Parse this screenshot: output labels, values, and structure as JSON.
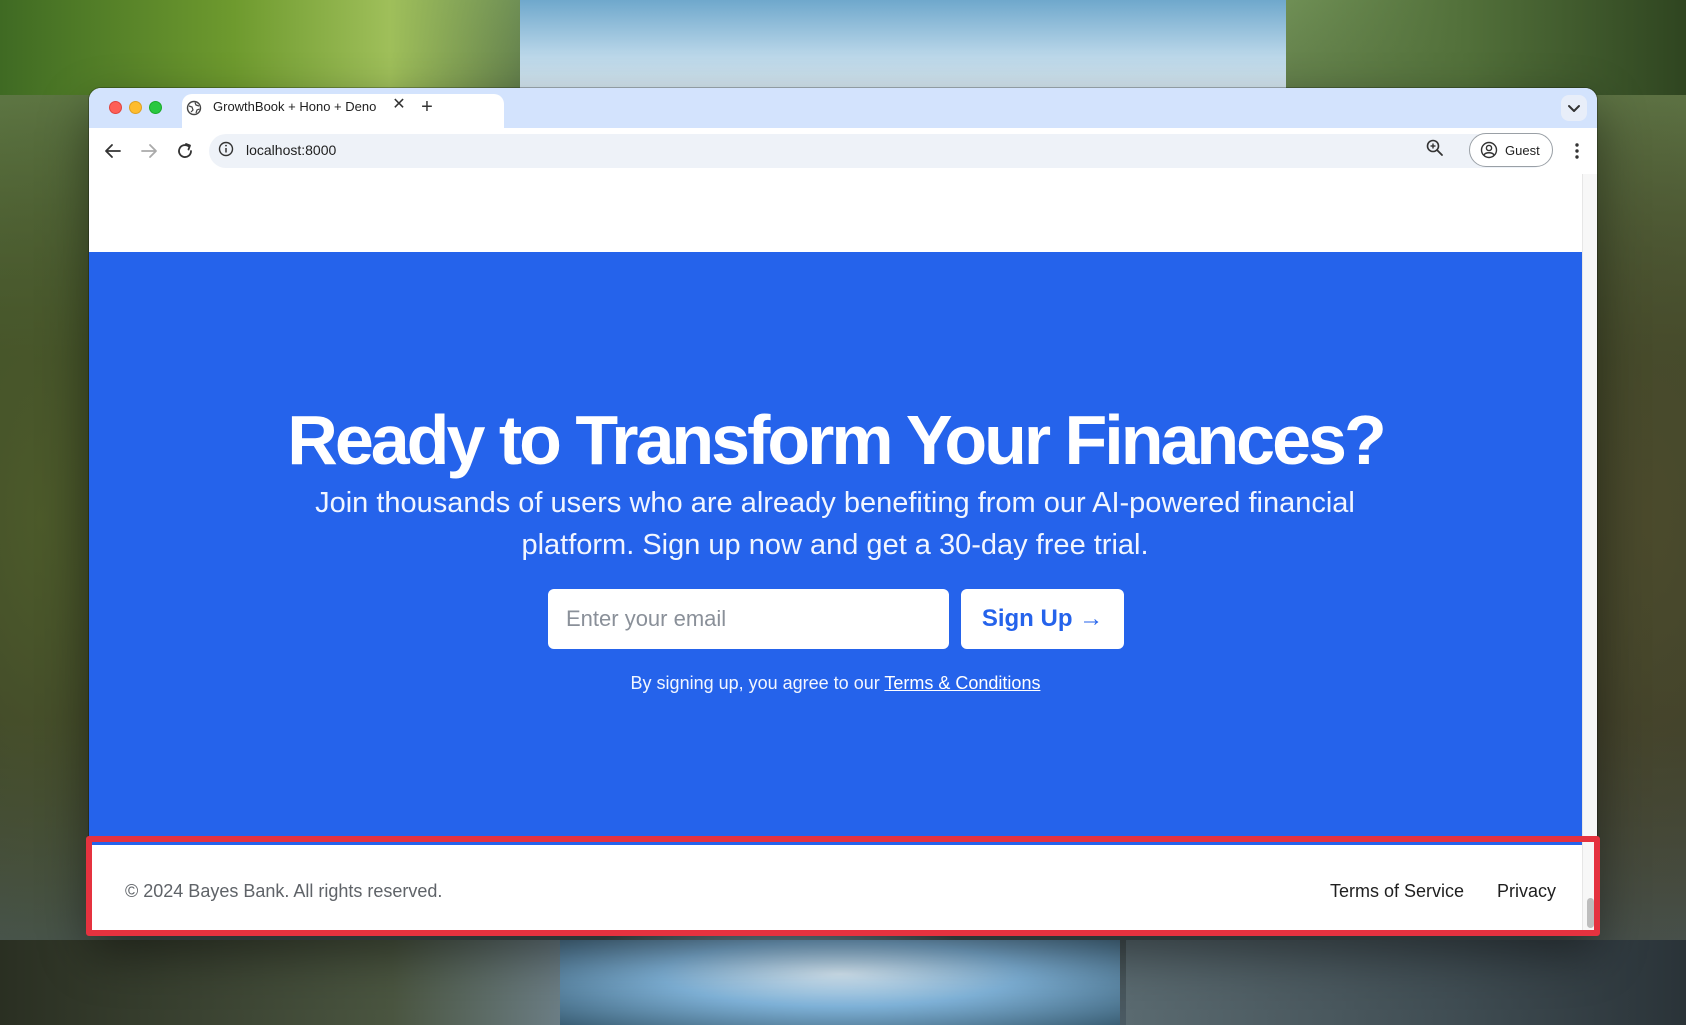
{
  "browser": {
    "tab_title": "GrowthBook + Hono + Deno",
    "tab_close": "✕",
    "new_tab": "+",
    "url": "localhost:8000",
    "profile_label": "Guest"
  },
  "hero": {
    "title": "Ready to Transform Your Finances?",
    "subtitle": "Join thousands of users who are already benefiting from our AI-powered financial platform. Sign up now and get a 30-day free trial.",
    "email_placeholder": "Enter your email",
    "signup_label": "Sign Up →",
    "agree_prefix": "By signing up, you agree to our ",
    "terms_link": "Terms & Conditions"
  },
  "footer": {
    "copyright": "© 2024 Bayes Bank. All rights reserved.",
    "links": [
      "Terms of Service",
      "Privacy"
    ]
  },
  "colors": {
    "hero_bg": "#2563eb",
    "highlight": "#e5323f",
    "tabstrip": "#d3e3fd"
  }
}
